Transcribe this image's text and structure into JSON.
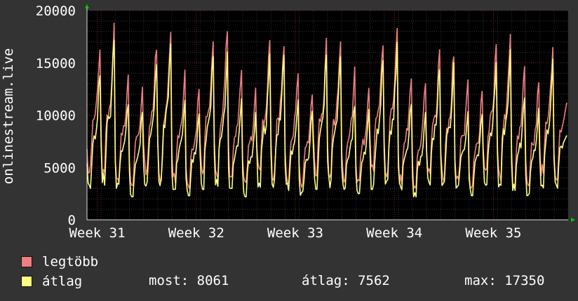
{
  "chart_data": {
    "type": "line",
    "ylabel": "onlinestream.live",
    "ylim": [
      0,
      20000
    ],
    "yticks": [
      "0",
      "5000",
      "10000",
      "15000",
      "20000"
    ],
    "xticks": [
      "Week 31",
      "Week 32",
      "Week 33",
      "Week 34",
      "Week 35"
    ],
    "days": 34,
    "series": [
      {
        "name": "legtöbb",
        "color": "#f07f7f",
        "daily_peaks": [
          16500,
          18500,
          14000,
          12800,
          16900,
          18700,
          14300,
          12800,
          17500,
          18100,
          14800,
          12400,
          17200,
          17300,
          14600,
          12100,
          17100,
          17800,
          14400,
          12900,
          17000,
          18200,
          14100,
          12800,
          16300,
          16100,
          13300,
          12100,
          16500,
          17800,
          14700,
          12900,
          16700,
          15000
        ],
        "daily_troughs": [
          4500,
          3800,
          3600,
          3300,
          4300,
          3700,
          3500,
          3000,
          4400,
          3900,
          3700,
          3100,
          4300,
          3800,
          3400,
          3000,
          4200,
          3700,
          3500,
          3100,
          4400,
          3800,
          3400,
          3000,
          4100,
          3600,
          3300,
          2900,
          4300,
          3700,
          3400,
          3100,
          4200,
          3800
        ],
        "last_value": 11200
      },
      {
        "name": "átlag",
        "color": "#ffff80",
        "daily_peaks": [
          14000,
          16900,
          11200,
          10500,
          15200,
          17200,
          11500,
          10300,
          16000,
          15800,
          11400,
          10100,
          15600,
          15800,
          11300,
          10200,
          15500,
          15600,
          11200,
          10400,
          15200,
          16700,
          11000,
          10200,
          14700,
          14800,
          10500,
          10000,
          15000,
          16000,
          11700,
          10600,
          15100,
          12600
        ],
        "daily_troughs": [
          3000,
          3300,
          3000,
          2200,
          2900,
          3100,
          2900,
          2300,
          2900,
          3200,
          3000,
          2200,
          2900,
          3100,
          2800,
          2300,
          2900,
          3000,
          2900,
          2500,
          2900,
          3100,
          2800,
          2200,
          2800,
          3000,
          2800,
          2300,
          2900,
          3100,
          2800,
          2300,
          2900,
          2800
        ],
        "last_value": 8061
      }
    ]
  },
  "legend": {
    "max_series_label": "legtöbb",
    "avg_series_label": "átlag"
  },
  "stats": {
    "current": "most: 8061",
    "average": "átlag: 7562",
    "maximum": "max: 17350"
  }
}
